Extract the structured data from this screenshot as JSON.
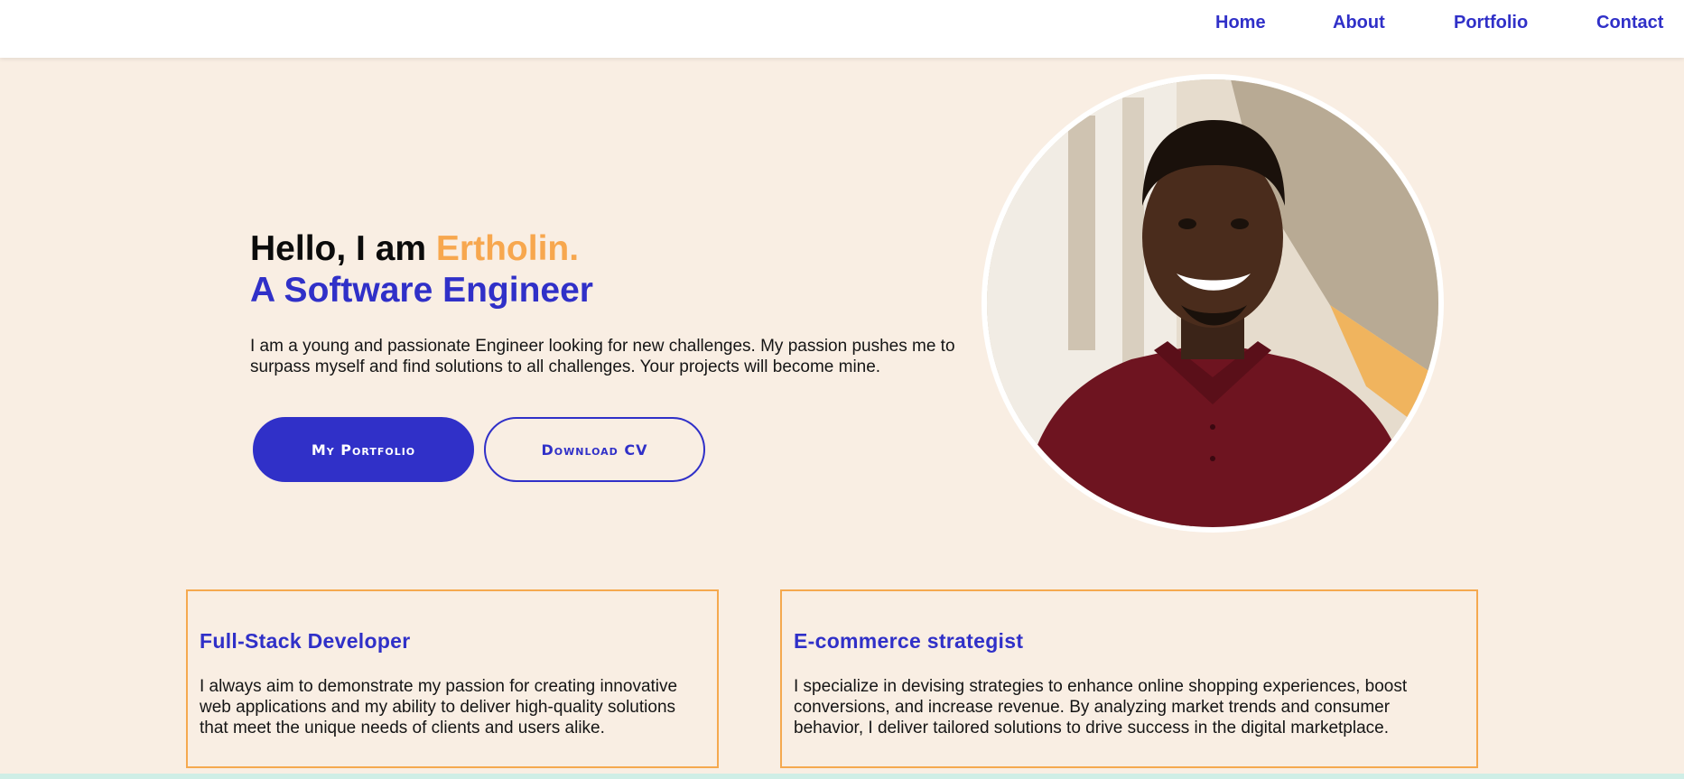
{
  "nav": {
    "links": [
      "Home",
      "About",
      "Portfolio",
      "Contact"
    ]
  },
  "hero": {
    "greeting": "Hello, I am ",
    "name": "Ertholin.",
    "subtitle": "A Software Engineer",
    "description": "I am a young and passionate Engineer looking for new challenges. My passion pushes me to surpass myself and find solutions to all challenges. Your projects will become mine.",
    "primary_button": "My Portfolio",
    "secondary_button": "Download CV"
  },
  "cards": [
    {
      "title": "Full-Stack Developer",
      "text": "I always aim to demonstrate my passion for creating innovative web applications and my ability to deliver high-quality solutions that meet the unique needs of clients and users alike."
    },
    {
      "title": "E-commerce strategist",
      "text": "I specialize in devising strategies to enhance online shopping experiences, boost conversions, and increase revenue. By analyzing market trends and consumer behavior, I deliver tailored solutions to drive success in the digital marketplace."
    }
  ],
  "colors": {
    "accent": "#3030c8",
    "highlight": "#f7a74e",
    "background": "#f9eee3",
    "card_border": "#f5a94f"
  },
  "icons": {
    "profile": "profile-photo"
  }
}
